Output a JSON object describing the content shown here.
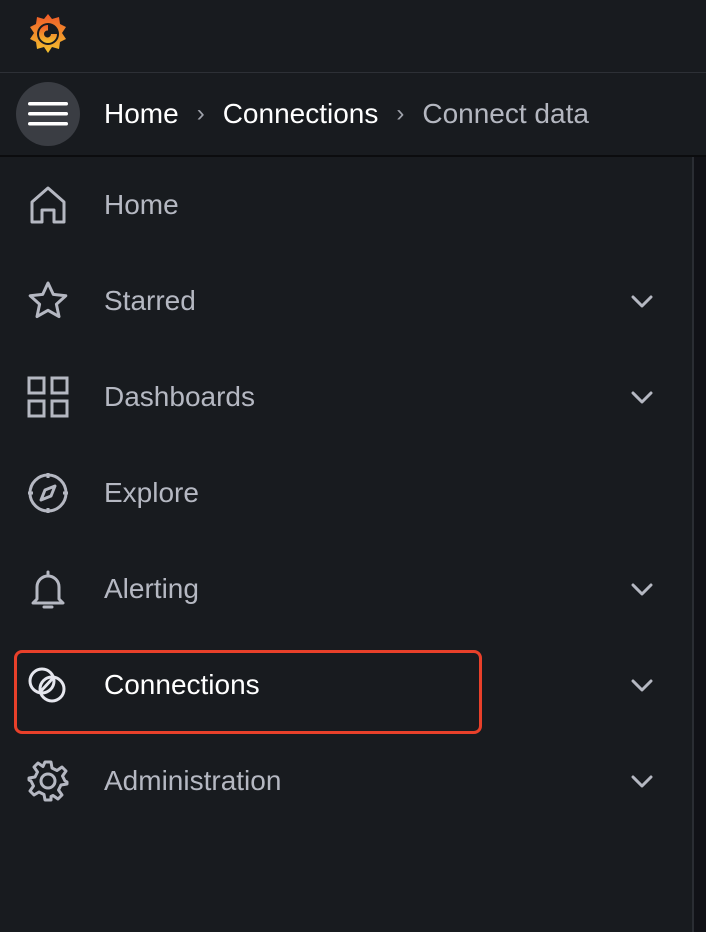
{
  "app": {
    "logo": "grafana-logo"
  },
  "breadcrumb": {
    "items": [
      "Home",
      "Connections"
    ],
    "current": "Connect data"
  },
  "nav": {
    "items": [
      {
        "label": "Home",
        "icon": "home-icon",
        "expandable": false
      },
      {
        "label": "Starred",
        "icon": "star-icon",
        "expandable": true
      },
      {
        "label": "Dashboards",
        "icon": "apps-icon",
        "expandable": true
      },
      {
        "label": "Explore",
        "icon": "compass-icon",
        "expandable": false
      },
      {
        "label": "Alerting",
        "icon": "bell-icon",
        "expandable": true
      },
      {
        "label": "Connections",
        "icon": "link-circles-icon",
        "expandable": true,
        "active": true
      },
      {
        "label": "Administration",
        "icon": "cog-icon",
        "expandable": true
      }
    ]
  },
  "colors": {
    "background": "#181b1f",
    "highlight": "#e8402a",
    "text": "#b5b8c2",
    "text_active": "#ffffff"
  }
}
